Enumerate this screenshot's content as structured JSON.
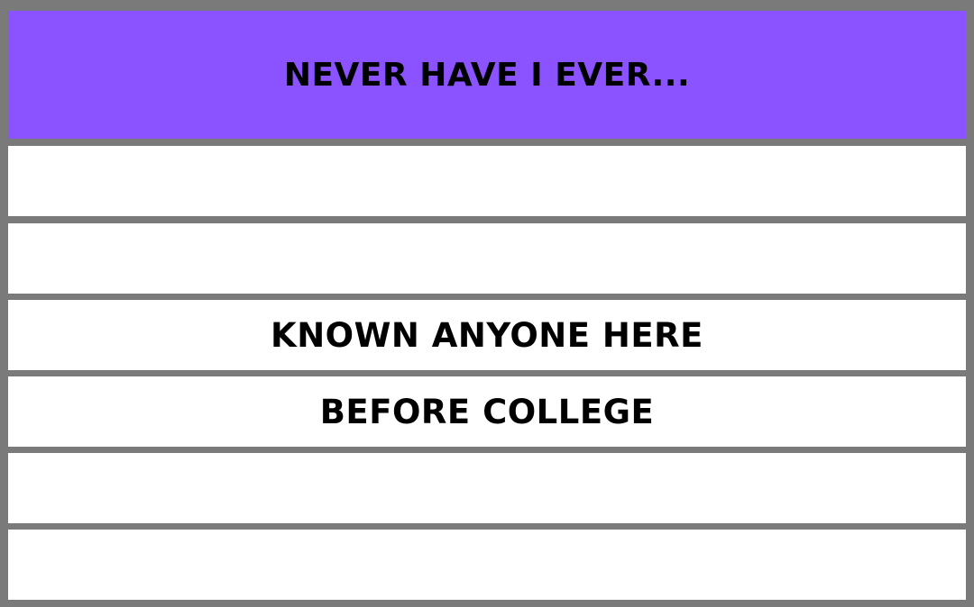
{
  "colors": {
    "header_bg": "#8b52ff",
    "row_bg": "#ffffff",
    "border": "#7a7a7a",
    "text": "#000000"
  },
  "header": {
    "title": "NEVER HAVE I EVER..."
  },
  "rows": [
    {
      "text": ""
    },
    {
      "text": ""
    },
    {
      "text": "KNOWN ANYONE HERE"
    },
    {
      "text": "BEFORE COLLEGE"
    },
    {
      "text": ""
    },
    {
      "text": ""
    }
  ]
}
